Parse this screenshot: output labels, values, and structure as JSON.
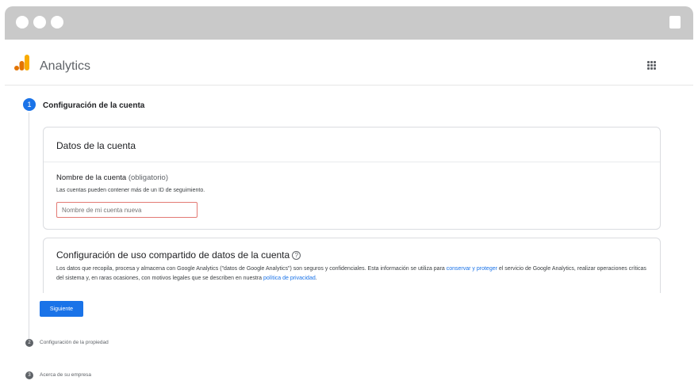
{
  "app": {
    "name": "Analytics"
  },
  "steps": [
    {
      "number": "1",
      "label": "Configuración de la cuenta"
    },
    {
      "number": "2",
      "label": "Configuración de la propiedad"
    },
    {
      "number": "3",
      "label": "Acerca de su empresa"
    }
  ],
  "account_card": {
    "title": "Datos de la cuenta",
    "field_label": "Nombre de la cuenta",
    "field_optional": "(obligatorio)",
    "field_help": "Las cuentas pueden contener más de un ID de seguimiento.",
    "field_placeholder": "Nombre de mi cuenta nueva"
  },
  "sharing_card": {
    "title": "Configuración de uso compartido de datos de la cuenta",
    "text_1": "Los datos que recopila, procesa y almacena con Google Analytics (\"datos de Google Analytics\") son seguros y confidenciales. Esta información se utiliza para",
    "link_1": "conservar y proteger",
    "text_2": "el servicio de Google Analytics, realizar operaciones críticas del sistema y, en raras ocasiones, con motivos legales que se describen en nuestra",
    "link_2": "política de privacidad",
    "text_3": "."
  },
  "buttons": {
    "next": "Siguiente"
  },
  "icons": {
    "help": "help-circle-icon",
    "apps": "apps-grid-icon",
    "logo": "analytics-logo-icon"
  },
  "colors": {
    "accent": "#1a73e8",
    "logo_orange": "#f9ab00",
    "logo_dark": "#e37400",
    "error_border": "#e37a74"
  }
}
